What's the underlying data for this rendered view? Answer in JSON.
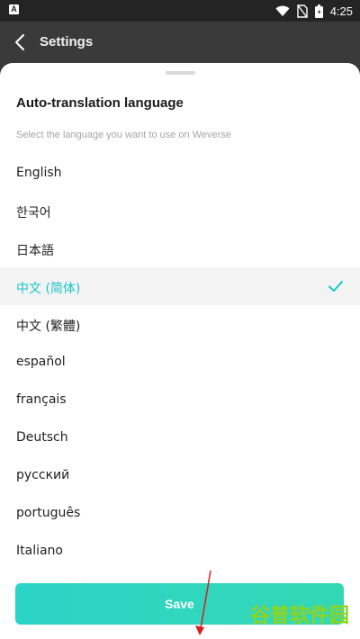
{
  "status_bar": {
    "time": "4:25"
  },
  "header": {
    "title": "Settings"
  },
  "sheet": {
    "title": "Auto-translation language",
    "subtitle": "Select the language you want to use on Weverse",
    "languages": [
      {
        "label": "English",
        "selected": false
      },
      {
        "label": "한국어",
        "selected": false
      },
      {
        "label": "日本語",
        "selected": false
      },
      {
        "label": "中文 (简体)",
        "selected": true
      },
      {
        "label": "中文 (繁體)",
        "selected": false
      },
      {
        "label": "español",
        "selected": false
      },
      {
        "label": "français",
        "selected": false
      },
      {
        "label": "Deutsch",
        "selected": false
      },
      {
        "label": "русский",
        "selected": false
      },
      {
        "label": "português",
        "selected": false
      },
      {
        "label": "Italiano",
        "selected": false
      }
    ],
    "save_label": "Save"
  },
  "watermark": {
    "text": "谷普软件园"
  },
  "colors": {
    "accent": "#19c5c5",
    "save_start": "#2cd4c8",
    "save_end": "#34d7b4"
  },
  "icons": [
    "back-arrow-icon",
    "wifi-icon",
    "no-sim-icon",
    "battery-icon",
    "checkmark-icon"
  ]
}
